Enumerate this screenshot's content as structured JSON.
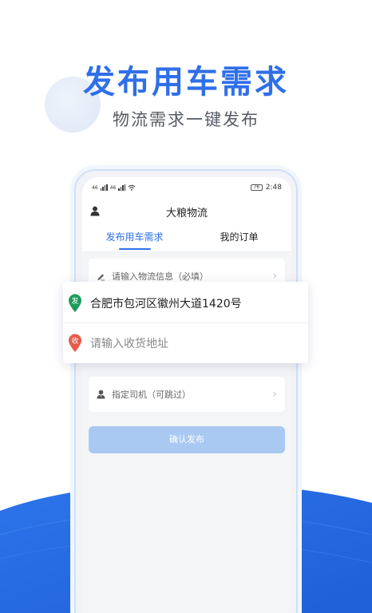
{
  "promo": {
    "headline": "发布用车需求",
    "subline": "物流需求一键发布"
  },
  "status_bar": {
    "signal_1": "46",
    "signal_2": "46",
    "battery": "76",
    "time": "2:48"
  },
  "app": {
    "title": "大粮物流",
    "tabs": [
      {
        "label": "发布用车需求",
        "active": true
      },
      {
        "label": "我的订单",
        "active": false
      }
    ]
  },
  "form": {
    "logistics_info_placeholder": "请输入物流信息（必填）",
    "driver_placeholder": "指定司机（可跳过）",
    "confirm_label": "确认发布"
  },
  "address_card": {
    "from_badge": "发",
    "from_value": "合肥市包河区徽州大道1420号",
    "to_badge": "收",
    "to_placeholder": "请输入收货地址"
  },
  "colors": {
    "brand_blue": "#2f6fe9",
    "from_pin": "#1e9a5c",
    "to_pin": "#e65a4a",
    "confirm_disabled": "#a9c8f2"
  }
}
